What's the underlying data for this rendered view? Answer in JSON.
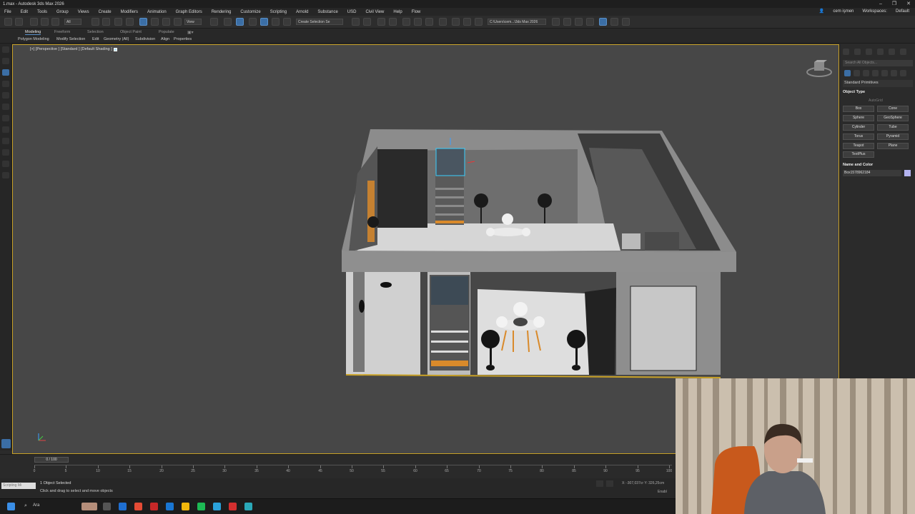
{
  "window": {
    "title": "1.max - Autodesk 3ds Max 2026"
  },
  "menu": [
    "File",
    "Edit",
    "Tools",
    "Group",
    "Views",
    "Create",
    "Modifiers",
    "Animation",
    "Graph Editors",
    "Rendering",
    "Customize",
    "Scripting",
    "Arnold",
    "Substance",
    "USD",
    "Civil View",
    "Help",
    "Flow"
  ],
  "user": {
    "name": "cem işmen",
    "workspace_label": "Workspaces:",
    "workspace_value": "Default"
  },
  "toolbar": {
    "filter_value": "All",
    "view_value": "View",
    "selection_set": "Create Selection Se",
    "path": "C:\\Users\\cem...\\3ds Max 2026"
  },
  "ribbon": {
    "tabs": [
      "Modeling",
      "Freeform",
      "Selection",
      "Object Paint",
      "Populate"
    ],
    "subtabs": [
      "Polygon Modeling",
      "Modify Selection",
      "Edit",
      "Geometry (All)",
      "Subdivision",
      "Align",
      "Properties"
    ]
  },
  "viewport": {
    "label": "[+] [Perspective ] [Standard ] [Default Shading ]"
  },
  "command_panel": {
    "search_placeholder": "Search All Objects...",
    "category": "Standard Primitives",
    "object_type_head": "Object Type",
    "autogrid": "AutoGrid",
    "buttons": [
      "Box",
      "Cone",
      "Sphere",
      "GeoSphere",
      "Cylinder",
      "Tube",
      "Torus",
      "Pyramid",
      "Teapot",
      "Plane",
      "TextPlus"
    ],
    "name_color_head": "Name and Color",
    "object_name": "Box1578962184",
    "object_color": "#b4b4f0"
  },
  "timeline": {
    "slider": "0 / 100",
    "ticks": [
      "0",
      "5",
      "10",
      "15",
      "20",
      "25",
      "30",
      "35",
      "40",
      "45",
      "50",
      "55",
      "60",
      "65",
      "70",
      "75",
      "80",
      "85",
      "90",
      "95",
      "100"
    ]
  },
  "status": {
    "selected": "1 Object Selected",
    "hint": "Click and drag to select and move objects",
    "maxscript": "Scripting Mi",
    "coords": "X: -307,037cr  Y: 326,25cm",
    "grid": "Enabl"
  },
  "taskbar": {
    "search": "Ara"
  },
  "colors": {
    "accent": "#3b6ea5",
    "selection_frame": "#c9a227",
    "viewport_bg": "#474747",
    "floor": "#c9c9c9",
    "chair_legs": "#d98a2b"
  }
}
